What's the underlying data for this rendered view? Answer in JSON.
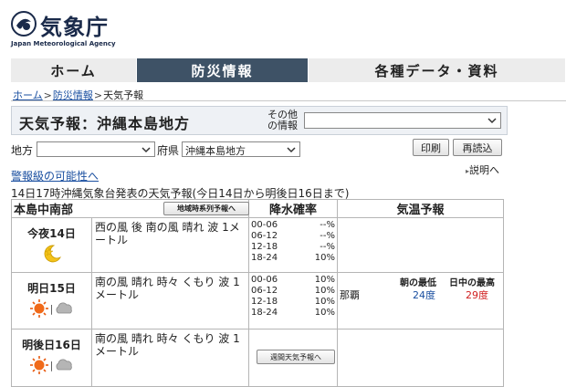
{
  "header": {
    "logo_jp": "気象庁",
    "logo_en": "Japan Meteorological Agency"
  },
  "nav": {
    "home": "ホーム",
    "bousai": "防災情報",
    "data": "各種データ・資料"
  },
  "breadcrumb": {
    "home": "ホーム",
    "bousai": "防災情報",
    "sep": ">",
    "current": "天気予報"
  },
  "title": {
    "text": "天気予報：沖縄本島地方",
    "other_info_label": "その他の情報",
    "other_info_value": ""
  },
  "filters": {
    "region_label": "地方",
    "region_value": "",
    "pref_label": "府県",
    "pref_value": "沖縄本島地方"
  },
  "buttons": {
    "print": "印刷",
    "reload": "再読込",
    "timeseries": "地域時系列予報へ",
    "weekly": "週間天気予報へ"
  },
  "links": {
    "warning": "警報級の可能性へ",
    "explain": "説明へ"
  },
  "announcement": "14日17時沖縄気象台発表の天気予報(今日14日から明後日16日まで)",
  "table": {
    "area_header": "本島中南部",
    "pop_header": "降水確率",
    "temp_header": "気温予報",
    "temp_morning_label": "朝の最低",
    "temp_day_label": "日中の最高",
    "days": [
      {
        "label": "今夜14日",
        "weather": "西の風 後 南の風 晴れ 波 1メートル",
        "icons": [
          "moon-star-icon"
        ],
        "pop": [
          {
            "time": "00-06",
            "value": "--%"
          },
          {
            "time": "06-12",
            "value": "--%"
          },
          {
            "time": "12-18",
            "value": "--%"
          },
          {
            "time": "18-24",
            "value": "10%"
          }
        ]
      },
      {
        "label": "明日15日",
        "weather": "南の風 晴れ 時々 くもり 波 1メートル",
        "icons": [
          "sun-icon",
          "cloud-icon"
        ],
        "sep": "|",
        "pop": [
          {
            "time": "00-06",
            "value": "10%"
          },
          {
            "time": "06-12",
            "value": "10%"
          },
          {
            "time": "12-18",
            "value": "10%"
          },
          {
            "time": "18-24",
            "value": "10%"
          }
        ],
        "temp": {
          "city": "那覇",
          "low": "24度",
          "high": "29度"
        }
      },
      {
        "label": "明後日16日",
        "weather": "南の風 晴れ 時々 くもり 波 1メートル",
        "icons": [
          "sun-icon",
          "cloud-icon"
        ],
        "sep": "|"
      }
    ]
  },
  "colors": {
    "nav_active": "#3e5266",
    "link": "#1a4fa0",
    "temp_low": "#1a4fa0",
    "temp_high": "#d02020"
  }
}
